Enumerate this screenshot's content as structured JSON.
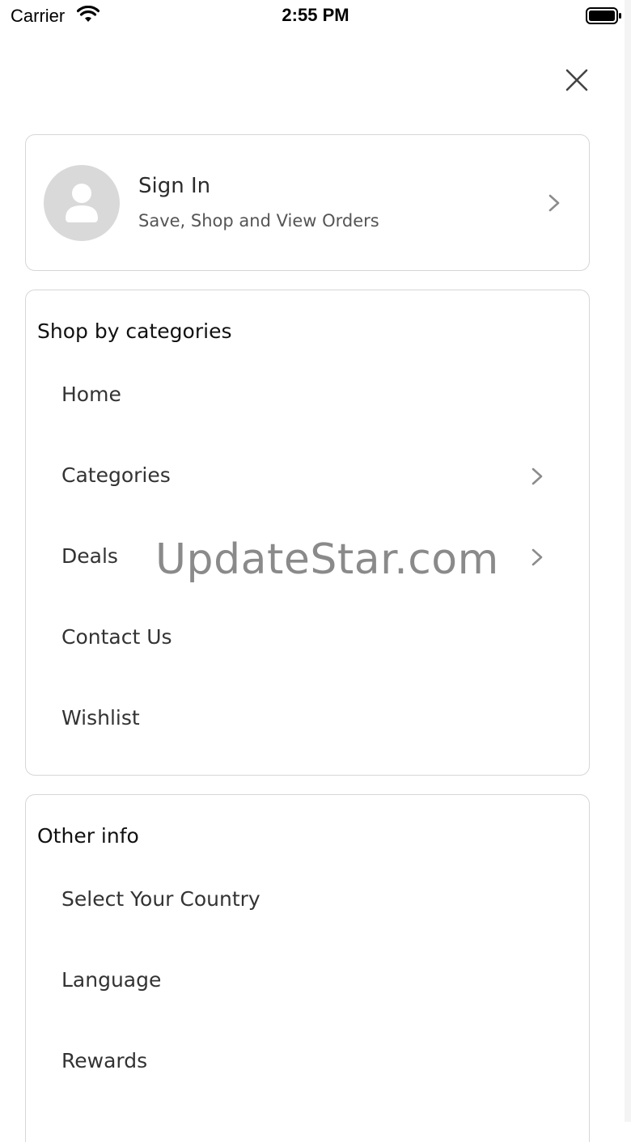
{
  "status_bar": {
    "carrier": "Carrier",
    "time": "2:55 PM"
  },
  "close_icon": "close-icon",
  "signin": {
    "title": "Sign In",
    "subtitle": "Save, Shop and View Orders"
  },
  "shop_section": {
    "title": "Shop by categories",
    "items": [
      {
        "label": "Home",
        "has_chevron": false
      },
      {
        "label": "Categories",
        "has_chevron": true
      },
      {
        "label": "Deals",
        "has_chevron": true
      },
      {
        "label": "Contact Us",
        "has_chevron": false
      },
      {
        "label": "Wishlist",
        "has_chevron": false
      }
    ]
  },
  "other_section": {
    "title": "Other info",
    "items": [
      {
        "label": "Select Your Country"
      },
      {
        "label": "Language"
      },
      {
        "label": "Rewards"
      }
    ]
  },
  "watermark": "UpdateStar.com",
  "colors": {
    "card_border": "#d6d6d6",
    "avatar_bg": "#d9d9d9",
    "chevron": "#8c8c8c"
  }
}
